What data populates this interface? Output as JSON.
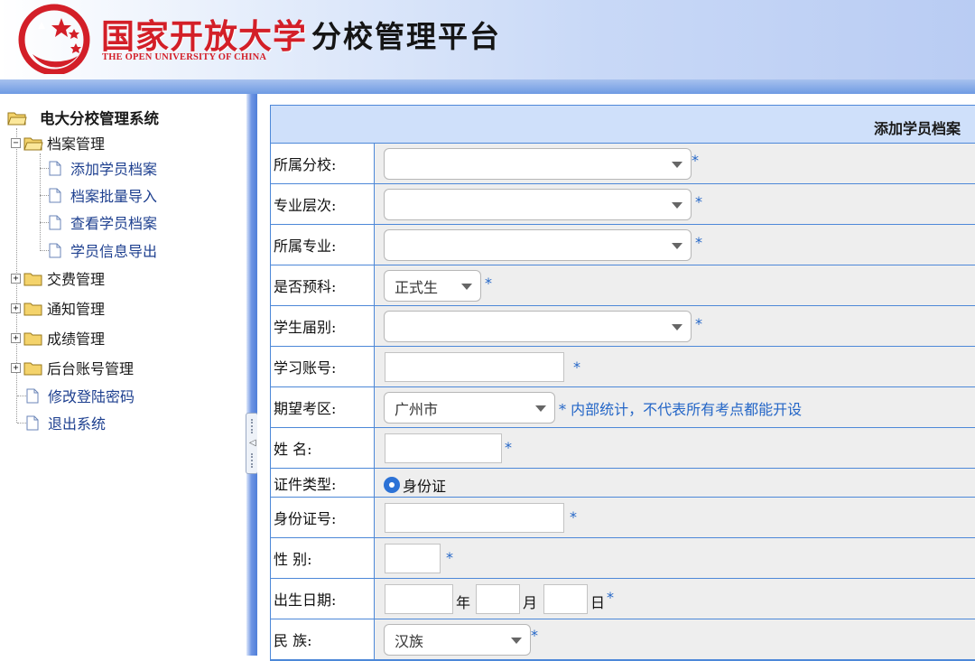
{
  "header": {
    "university_cn": "国家开放大学",
    "university_en": "THE OPEN UNIVERSITY OF CHINA",
    "platform_title": "分校管理平台"
  },
  "sidebar": {
    "root": "电大分校管理系统",
    "groups": [
      {
        "label": "档案管理",
        "expanded": true,
        "items": [
          "添加学员档案",
          "档案批量导入",
          "查看学员档案",
          "学员信息导出"
        ]
      },
      {
        "label": "交费管理",
        "expanded": false
      },
      {
        "label": "通知管理",
        "expanded": false
      },
      {
        "label": "成绩管理",
        "expanded": false
      },
      {
        "label": "后台账号管理",
        "expanded": false
      }
    ],
    "links": [
      "修改登陆密码",
      "退出系统"
    ]
  },
  "form": {
    "title": "添加学员档案",
    "required_mark": "*",
    "fields": {
      "branch": {
        "label": "所属分校:",
        "value": ""
      },
      "level": {
        "label": "专业层次:",
        "value": ""
      },
      "major": {
        "label": "所属专业:",
        "value": ""
      },
      "preparatory": {
        "label": "是否预科:",
        "value": "正式生"
      },
      "cohort": {
        "label": "学生届别:",
        "value": ""
      },
      "account": {
        "label": "学习账号:",
        "value": ""
      },
      "exam_area": {
        "label": "期望考区:",
        "value": "广州市",
        "note": "* 内部统计，不代表所有考点都能开设"
      },
      "name": {
        "label": "姓 名:",
        "value": ""
      },
      "id_type": {
        "label": "证件类型:",
        "option": "身份证"
      },
      "id_number": {
        "label": "身份证号:",
        "value": ""
      },
      "gender": {
        "label": "性 别:",
        "value": ""
      },
      "birth_date": {
        "label": "出生日期:",
        "year_unit": "年",
        "month_unit": "月",
        "day_unit": "日"
      },
      "ethnicity": {
        "label": "民 族:",
        "value": "汉族"
      }
    }
  },
  "colors": {
    "accent_blue": "#4d88d8",
    "header_fill": "#cfe0fa",
    "required_blue": "#2466c7",
    "logo_red": "#d31f28"
  }
}
